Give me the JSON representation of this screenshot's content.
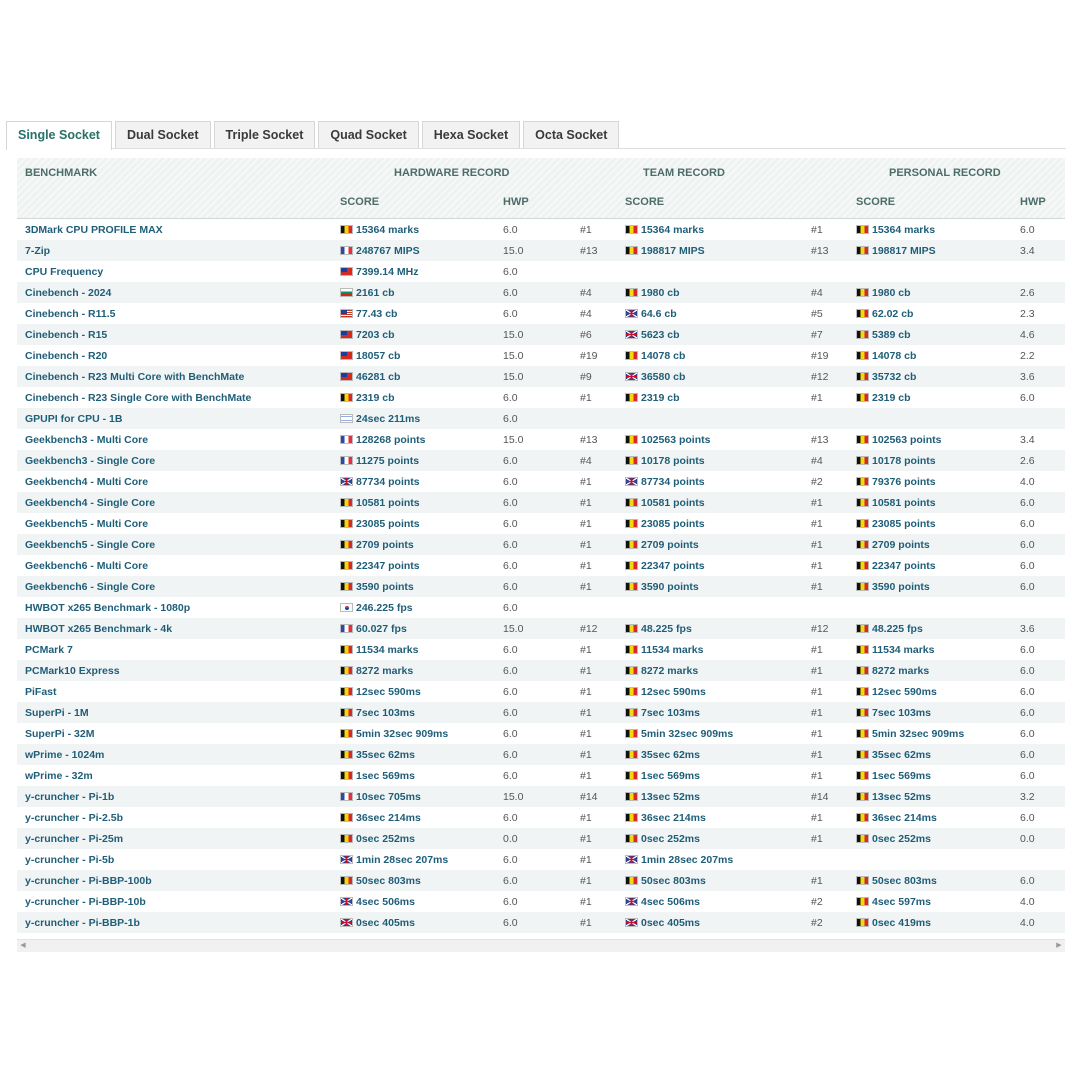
{
  "tabs": [
    "Single Socket",
    "Dual Socket",
    "Triple Socket",
    "Quad Socket",
    "Hexa Socket",
    "Octa Socket"
  ],
  "headers": {
    "benchmark": "BENCHMARK",
    "hardware": "HARDWARE RECORD",
    "team": "TEAM RECORD",
    "personal": "PERSONAL RECORD",
    "score": "SCORE",
    "hwp": "HWP"
  },
  "rows": [
    {
      "bench": "3DMark CPU PROFILE MAX",
      "hw_flag": "be",
      "hw_score": "15364 marks",
      "hw_hwp": "6.0",
      "team_rank": "#1",
      "team_flag": "be",
      "team_score": "15364 marks",
      "pers_rank": "#1",
      "pers_flag": "be",
      "pers_score": "15364 marks",
      "pers_hwp": "6.0"
    },
    {
      "bench": "7-Zip",
      "hw_flag": "fr",
      "hw_score": "248767 MIPS",
      "hw_hwp": "15.0",
      "team_rank": "#13",
      "team_flag": "be",
      "team_score": "198817 MIPS",
      "pers_rank": "#13",
      "pers_flag": "be",
      "pers_score": "198817 MIPS",
      "pers_hwp": "3.4"
    },
    {
      "bench": "CPU Frequency",
      "hw_flag": "tw",
      "hw_score": "7399.14 MHz",
      "hw_hwp": "6.0",
      "team_rank": "",
      "team_flag": "",
      "team_score": "",
      "pers_rank": "",
      "pers_flag": "",
      "pers_score": "",
      "pers_hwp": ""
    },
    {
      "bench": "Cinebench - 2024",
      "hw_flag": "bg",
      "hw_score": "2161 cb",
      "hw_hwp": "6.0",
      "team_rank": "#4",
      "team_flag": "be",
      "team_score": "1980 cb",
      "pers_rank": "#4",
      "pers_flag": "be",
      "pers_score": "1980 cb",
      "pers_hwp": "2.6"
    },
    {
      "bench": "Cinebench - R11.5",
      "hw_flag": "us",
      "hw_score": "77.43 cb",
      "hw_hwp": "6.0",
      "team_rank": "#4",
      "team_flag": "gb",
      "team_score": "64.6 cb",
      "pers_rank": "#5",
      "pers_flag": "be",
      "pers_score": "62.02 cb",
      "pers_hwp": "2.3"
    },
    {
      "bench": "Cinebench - R15",
      "hw_flag": "tw",
      "hw_score": "7203 cb",
      "hw_hwp": "15.0",
      "team_rank": "#6",
      "team_flag": "gb",
      "team_score": "5623 cb",
      "pers_rank": "#7",
      "pers_flag": "be",
      "pers_score": "5389 cb",
      "pers_hwp": "4.6"
    },
    {
      "bench": "Cinebench - R20",
      "hw_flag": "tw",
      "hw_score": "18057 cb",
      "hw_hwp": "15.0",
      "team_rank": "#19",
      "team_flag": "be",
      "team_score": "14078 cb",
      "pers_rank": "#19",
      "pers_flag": "be",
      "pers_score": "14078 cb",
      "pers_hwp": "2.2"
    },
    {
      "bench": "Cinebench - R23 Multi Core with BenchMate",
      "hw_flag": "tw",
      "hw_score": "46281 cb",
      "hw_hwp": "15.0",
      "team_rank": "#9",
      "team_flag": "gb",
      "team_score": "36580 cb",
      "pers_rank": "#12",
      "pers_flag": "be",
      "pers_score": "35732 cb",
      "pers_hwp": "3.6"
    },
    {
      "bench": "Cinebench - R23 Single Core with BenchMate",
      "hw_flag": "be",
      "hw_score": "2319 cb",
      "hw_hwp": "6.0",
      "team_rank": "#1",
      "team_flag": "be",
      "team_score": "2319 cb",
      "pers_rank": "#1",
      "pers_flag": "be",
      "pers_score": "2319 cb",
      "pers_hwp": "6.0"
    },
    {
      "bench": "GPUPI for CPU - 1B",
      "hw_flag": "il",
      "hw_score": "24sec 211ms",
      "hw_hwp": "6.0",
      "team_rank": "",
      "team_flag": "",
      "team_score": "",
      "pers_rank": "",
      "pers_flag": "",
      "pers_score": "",
      "pers_hwp": ""
    },
    {
      "bench": "Geekbench3 - Multi Core",
      "hw_flag": "fr",
      "hw_score": "128268 points",
      "hw_hwp": "15.0",
      "team_rank": "#13",
      "team_flag": "be",
      "team_score": "102563 points",
      "pers_rank": "#13",
      "pers_flag": "be",
      "pers_score": "102563 points",
      "pers_hwp": "3.4"
    },
    {
      "bench": "Geekbench3 - Single Core",
      "hw_flag": "fr",
      "hw_score": "11275 points",
      "hw_hwp": "6.0",
      "team_rank": "#4",
      "team_flag": "be",
      "team_score": "10178 points",
      "pers_rank": "#4",
      "pers_flag": "be",
      "pers_score": "10178 points",
      "pers_hwp": "2.6"
    },
    {
      "bench": "Geekbench4 - Multi Core",
      "hw_flag": "gb",
      "hw_score": "87734 points",
      "hw_hwp": "6.0",
      "team_rank": "#1",
      "team_flag": "gb",
      "team_score": "87734 points",
      "pers_rank": "#2",
      "pers_flag": "be",
      "pers_score": "79376 points",
      "pers_hwp": "4.0"
    },
    {
      "bench": "Geekbench4 - Single Core",
      "hw_flag": "be",
      "hw_score": "10581 points",
      "hw_hwp": "6.0",
      "team_rank": "#1",
      "team_flag": "be",
      "team_score": "10581 points",
      "pers_rank": "#1",
      "pers_flag": "be",
      "pers_score": "10581 points",
      "pers_hwp": "6.0"
    },
    {
      "bench": "Geekbench5 - Multi Core",
      "hw_flag": "be",
      "hw_score": "23085 points",
      "hw_hwp": "6.0",
      "team_rank": "#1",
      "team_flag": "be",
      "team_score": "23085 points",
      "pers_rank": "#1",
      "pers_flag": "be",
      "pers_score": "23085 points",
      "pers_hwp": "6.0"
    },
    {
      "bench": "Geekbench5 - Single Core",
      "hw_flag": "be",
      "hw_score": "2709 points",
      "hw_hwp": "6.0",
      "team_rank": "#1",
      "team_flag": "be",
      "team_score": "2709 points",
      "pers_rank": "#1",
      "pers_flag": "be",
      "pers_score": "2709 points",
      "pers_hwp": "6.0"
    },
    {
      "bench": "Geekbench6 - Multi Core",
      "hw_flag": "be",
      "hw_score": "22347 points",
      "hw_hwp": "6.0",
      "team_rank": "#1",
      "team_flag": "be",
      "team_score": "22347 points",
      "pers_rank": "#1",
      "pers_flag": "be",
      "pers_score": "22347 points",
      "pers_hwp": "6.0"
    },
    {
      "bench": "Geekbench6 - Single Core",
      "hw_flag": "be",
      "hw_score": "3590 points",
      "hw_hwp": "6.0",
      "team_rank": "#1",
      "team_flag": "be",
      "team_score": "3590 points",
      "pers_rank": "#1",
      "pers_flag": "be",
      "pers_score": "3590 points",
      "pers_hwp": "6.0"
    },
    {
      "bench": "HWBOT x265 Benchmark - 1080p",
      "hw_flag": "kr",
      "hw_score": "246.225 fps",
      "hw_hwp": "6.0",
      "team_rank": "",
      "team_flag": "",
      "team_score": "",
      "pers_rank": "",
      "pers_flag": "",
      "pers_score": "",
      "pers_hwp": ""
    },
    {
      "bench": "HWBOT x265 Benchmark - 4k",
      "hw_flag": "fr",
      "hw_score": "60.027 fps",
      "hw_hwp": "15.0",
      "team_rank": "#12",
      "team_flag": "be",
      "team_score": "48.225 fps",
      "pers_rank": "#12",
      "pers_flag": "be",
      "pers_score": "48.225 fps",
      "pers_hwp": "3.6"
    },
    {
      "bench": "PCMark 7",
      "hw_flag": "be",
      "hw_score": "11534 marks",
      "hw_hwp": "6.0",
      "team_rank": "#1",
      "team_flag": "be",
      "team_score": "11534 marks",
      "pers_rank": "#1",
      "pers_flag": "be",
      "pers_score": "11534 marks",
      "pers_hwp": "6.0"
    },
    {
      "bench": "PCMark10 Express",
      "hw_flag": "be",
      "hw_score": "8272 marks",
      "hw_hwp": "6.0",
      "team_rank": "#1",
      "team_flag": "be",
      "team_score": "8272 marks",
      "pers_rank": "#1",
      "pers_flag": "be",
      "pers_score": "8272 marks",
      "pers_hwp": "6.0"
    },
    {
      "bench": "PiFast",
      "hw_flag": "be",
      "hw_score": "12sec 590ms",
      "hw_hwp": "6.0",
      "team_rank": "#1",
      "team_flag": "be",
      "team_score": "12sec 590ms",
      "pers_rank": "#1",
      "pers_flag": "be",
      "pers_score": "12sec 590ms",
      "pers_hwp": "6.0"
    },
    {
      "bench": "SuperPi - 1M",
      "hw_flag": "be",
      "hw_score": "7sec 103ms",
      "hw_hwp": "6.0",
      "team_rank": "#1",
      "team_flag": "be",
      "team_score": "7sec 103ms",
      "pers_rank": "#1",
      "pers_flag": "be",
      "pers_score": "7sec 103ms",
      "pers_hwp": "6.0"
    },
    {
      "bench": "SuperPi - 32M",
      "hw_flag": "be",
      "hw_score": "5min 32sec 909ms",
      "hw_hwp": "6.0",
      "team_rank": "#1",
      "team_flag": "be",
      "team_score": "5min 32sec 909ms",
      "pers_rank": "#1",
      "pers_flag": "be",
      "pers_score": "5min 32sec 909ms",
      "pers_hwp": "6.0"
    },
    {
      "bench": "wPrime - 1024m",
      "hw_flag": "be",
      "hw_score": "35sec 62ms",
      "hw_hwp": "6.0",
      "team_rank": "#1",
      "team_flag": "be",
      "team_score": "35sec 62ms",
      "pers_rank": "#1",
      "pers_flag": "be",
      "pers_score": "35sec 62ms",
      "pers_hwp": "6.0"
    },
    {
      "bench": "wPrime - 32m",
      "hw_flag": "be",
      "hw_score": "1sec 569ms",
      "hw_hwp": "6.0",
      "team_rank": "#1",
      "team_flag": "be",
      "team_score": "1sec 569ms",
      "pers_rank": "#1",
      "pers_flag": "be",
      "pers_score": "1sec 569ms",
      "pers_hwp": "6.0"
    },
    {
      "bench": "y-cruncher - Pi-1b",
      "hw_flag": "fr",
      "hw_score": "10sec 705ms",
      "hw_hwp": "15.0",
      "team_rank": "#14",
      "team_flag": "be",
      "team_score": "13sec 52ms",
      "pers_rank": "#14",
      "pers_flag": "be",
      "pers_score": "13sec 52ms",
      "pers_hwp": "3.2"
    },
    {
      "bench": "y-cruncher - Pi-2.5b",
      "hw_flag": "be",
      "hw_score": "36sec 214ms",
      "hw_hwp": "6.0",
      "team_rank": "#1",
      "team_flag": "be",
      "team_score": "36sec 214ms",
      "pers_rank": "#1",
      "pers_flag": "be",
      "pers_score": "36sec 214ms",
      "pers_hwp": "6.0"
    },
    {
      "bench": "y-cruncher - Pi-25m",
      "hw_flag": "be",
      "hw_score": "0sec 252ms",
      "hw_hwp": "0.0",
      "team_rank": "#1",
      "team_flag": "be",
      "team_score": "0sec 252ms",
      "pers_rank": "#1",
      "pers_flag": "be",
      "pers_score": "0sec 252ms",
      "pers_hwp": "0.0"
    },
    {
      "bench": "y-cruncher - Pi-5b",
      "hw_flag": "gb",
      "hw_score": "1min 28sec 207ms",
      "hw_hwp": "6.0",
      "team_rank": "#1",
      "team_flag": "gb",
      "team_score": "1min 28sec 207ms",
      "pers_rank": "",
      "pers_flag": "",
      "pers_score": "",
      "pers_hwp": ""
    },
    {
      "bench": "y-cruncher - Pi-BBP-100b",
      "hw_flag": "be",
      "hw_score": "50sec 803ms",
      "hw_hwp": "6.0",
      "team_rank": "#1",
      "team_flag": "be",
      "team_score": "50sec 803ms",
      "pers_rank": "#1",
      "pers_flag": "be",
      "pers_score": "50sec 803ms",
      "pers_hwp": "6.0"
    },
    {
      "bench": "y-cruncher - Pi-BBP-10b",
      "hw_flag": "gb",
      "hw_score": "4sec 506ms",
      "hw_hwp": "6.0",
      "team_rank": "#1",
      "team_flag": "gb",
      "team_score": "4sec 506ms",
      "pers_rank": "#2",
      "pers_flag": "be",
      "pers_score": "4sec 597ms",
      "pers_hwp": "4.0"
    },
    {
      "bench": "y-cruncher - Pi-BBP-1b",
      "hw_flag": "gb",
      "hw_score": "0sec 405ms",
      "hw_hwp": "6.0",
      "team_rank": "#1",
      "team_flag": "gb",
      "team_score": "0sec 405ms",
      "pers_rank": "#2",
      "pers_flag": "be",
      "pers_score": "0sec 419ms",
      "pers_hwp": "4.0"
    }
  ]
}
